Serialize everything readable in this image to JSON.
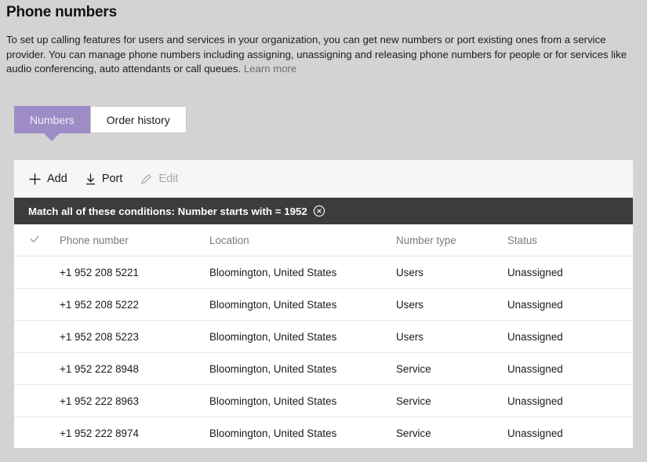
{
  "header": {
    "title": "Phone numbers",
    "intro_text": "To set up calling features for users and services in your organization, you can get new numbers or port existing ones from a service provider. You can manage phone numbers including assigning, unassigning and releasing phone numbers for people or for services like audio conferencing, auto attendants or call queues.",
    "learn_more_label": "Learn more"
  },
  "tabs": [
    {
      "label": "Numbers",
      "active": true
    },
    {
      "label": "Order history",
      "active": false
    }
  ],
  "toolbar": {
    "add_label": "Add",
    "port_label": "Port",
    "edit_label": "Edit",
    "add_icon": "plus-icon",
    "port_icon": "download-icon",
    "edit_icon": "pencil-icon",
    "edit_disabled": true
  },
  "filter": {
    "text": "Match all of these conditions: Number starts with = 1952",
    "clear_icon": "circle-x-icon"
  },
  "table": {
    "select_all_icon": "checkmark-icon",
    "columns": [
      "Phone number",
      "Location",
      "Number type",
      "Status"
    ],
    "rows": [
      {
        "phone": "+1 952 208 5221",
        "location": "Bloomington, United States",
        "type": "Users",
        "status": "Unassigned"
      },
      {
        "phone": "+1 952 208 5222",
        "location": "Bloomington, United States",
        "type": "Users",
        "status": "Unassigned"
      },
      {
        "phone": "+1 952 208 5223",
        "location": "Bloomington, United States",
        "type": "Users",
        "status": "Unassigned"
      },
      {
        "phone": "+1 952 222 8948",
        "location": "Bloomington, United States",
        "type": "Service",
        "status": "Unassigned"
      },
      {
        "phone": "+1 952 222 8963",
        "location": "Bloomington, United States",
        "type": "Service",
        "status": "Unassigned"
      },
      {
        "phone": "+1 952 222 8974",
        "location": "Bloomington, United States",
        "type": "Service",
        "status": "Unassigned"
      }
    ]
  },
  "colors": {
    "page_background": "#d3d3d3",
    "accent_purple": "#9e8cc6",
    "filter_bar": "#3c3c3c",
    "panel_background": "#ffffff",
    "commandbar_background": "#f6f6f6",
    "link": "#6b6b72",
    "disabled_text": "#a9a9a9"
  }
}
